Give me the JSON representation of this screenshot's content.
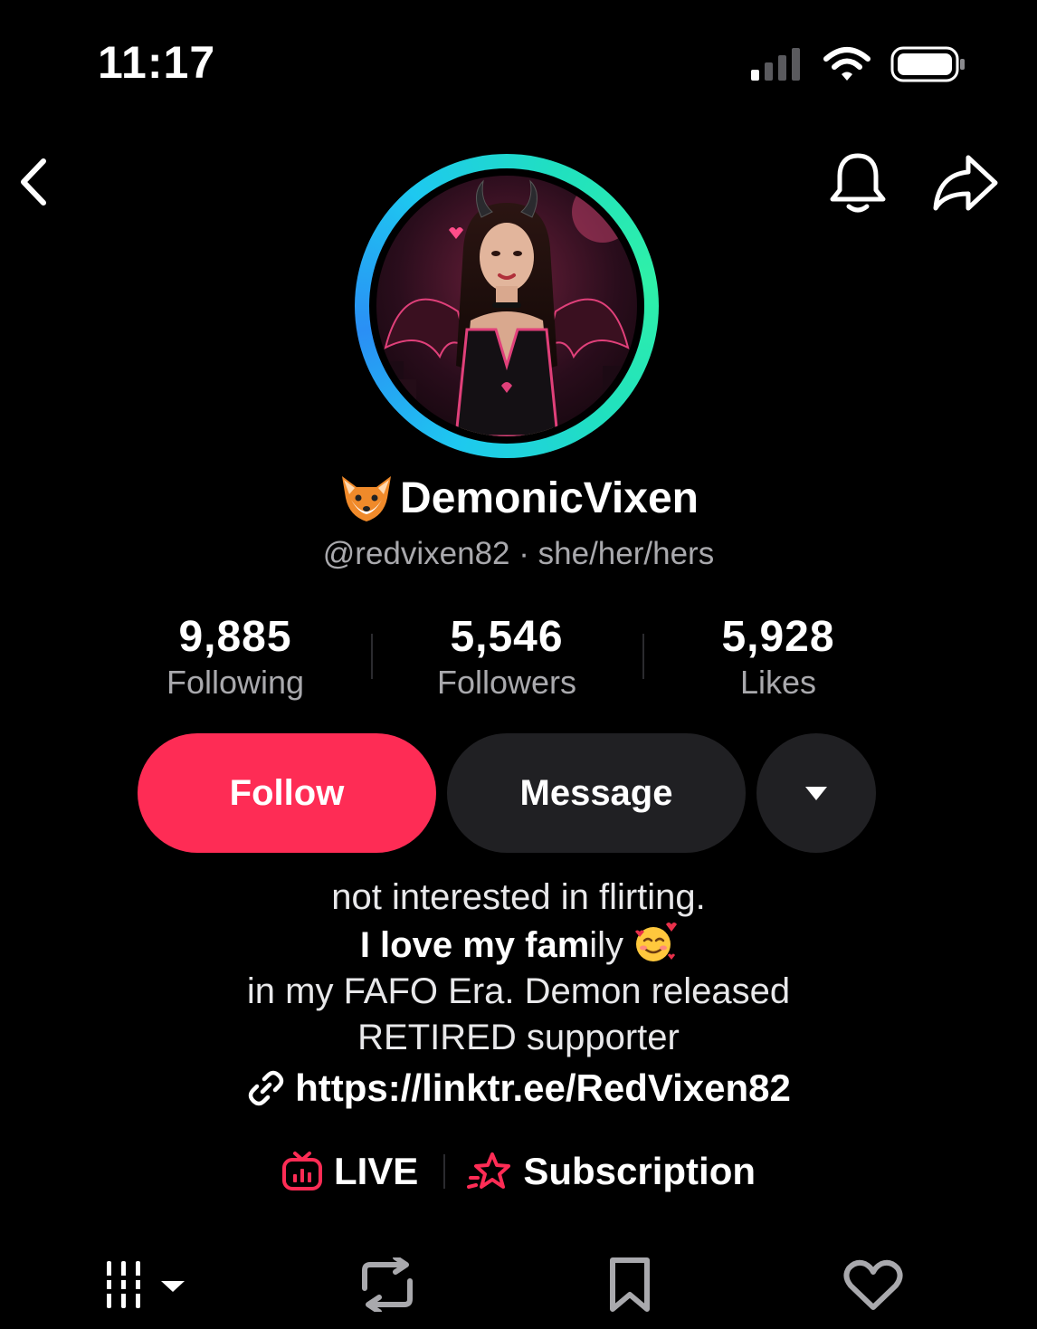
{
  "status_bar": {
    "time": "11:17",
    "signal_icon": "signal-icon",
    "wifi_icon": "wifi-icon",
    "battery_icon": "battery-icon"
  },
  "nav": {
    "back_icon": "chevron-left-icon",
    "bell_icon": "bell-icon",
    "share_icon": "share-arrow-icon"
  },
  "profile": {
    "display_name": "DemonicVixen",
    "name_emoji": "fox-face-icon",
    "handle": "@redvixen82",
    "separator": "·",
    "pronouns": "she/her/hers"
  },
  "stats": [
    {
      "value": "9,885",
      "label": "Following"
    },
    {
      "value": "5,546",
      "label": "Followers"
    },
    {
      "value": "5,928",
      "label": "Likes"
    }
  ],
  "actions": {
    "follow_label": "Follow",
    "message_label": "Message",
    "more_icon": "caret-down-icon"
  },
  "bio": {
    "line1": "not interested in flirting.",
    "line2_bold": "I love my fam",
    "line2_rest": "ily",
    "line2_emoji": "smiling-face-with-hearts-icon",
    "line3": "in my FAFO Era. Demon released",
    "line4": "RETIRED supporter",
    "link_icon": "link-icon",
    "link": "https://linktr.ee/RedVixen82"
  },
  "extras": {
    "live_label": "LIVE",
    "subscription_label": "Subscription"
  },
  "tabs": [
    {
      "icon": "videos-grid-icon",
      "has_dropdown": true
    },
    {
      "icon": "repost-icon"
    },
    {
      "icon": "bookmark-icon"
    },
    {
      "icon": "heart-icon"
    }
  ],
  "colors": {
    "accent": "#fe2c55",
    "button_dark": "#202023",
    "muted_text": "#a9a9ad",
    "ring_cyan": "#1ec8f0",
    "ring_green": "#2ff0a8"
  }
}
